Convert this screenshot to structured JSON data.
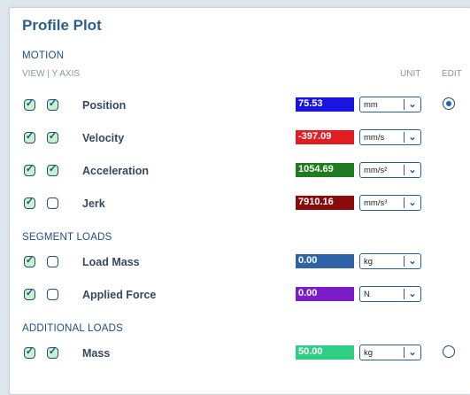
{
  "title": "Profile Plot",
  "sections": {
    "motion": "MOTION",
    "segment_loads": "SEGMENT LOADS",
    "additional_loads": "ADDITIONAL LOADS"
  },
  "headers": {
    "view_yaxis": "VIEW | Y AXIS",
    "unit": "UNIT",
    "edit": "EDIT"
  },
  "rows": [
    {
      "label": "Position",
      "view": true,
      "yaxis": true,
      "value": "75.53",
      "color": "#1a14e0",
      "unit": "mm",
      "edit": "selected"
    },
    {
      "label": "Velocity",
      "view": true,
      "yaxis": true,
      "value": "-397.09",
      "color": "#e31b23",
      "unit": "mm/s",
      "edit": "none"
    },
    {
      "label": "Acceleration",
      "view": true,
      "yaxis": true,
      "value": "1054.69",
      "color": "#1e7b1e",
      "unit": "mm/s²",
      "edit": "none"
    },
    {
      "label": "Jerk",
      "view": true,
      "yaxis": false,
      "value": "7910.16",
      "color": "#8b0a0a",
      "unit": "mm/s³",
      "edit": "none"
    },
    {
      "label": "Load Mass",
      "view": true,
      "yaxis": false,
      "value": "0.00",
      "color": "#2f63a8",
      "unit": "kg",
      "edit": "none"
    },
    {
      "label": "Applied Force",
      "view": true,
      "yaxis": false,
      "value": "0.00",
      "color": "#7a1cc8",
      "unit": "N",
      "edit": "none"
    },
    {
      "label": "Mass",
      "view": true,
      "yaxis": true,
      "value": "50.00",
      "color": "#2ecf85",
      "unit": "kg",
      "edit": "unselected"
    }
  ]
}
